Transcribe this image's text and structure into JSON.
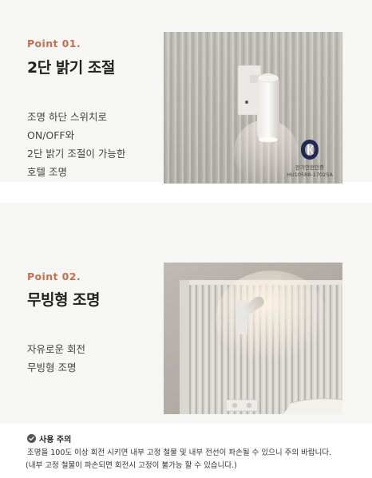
{
  "colors": {
    "accent": "#c8704a",
    "panel_bg": "#f6f6f5",
    "text_dark": "#222222",
    "text_body": "#444444"
  },
  "point1": {
    "label": "Point 01.",
    "title": "2단 밝기 조절",
    "desc": [
      "조명 하단 스위치로",
      "ON/OFF와",
      "2단 밝기 조절이 가능한",
      "호텔 조명"
    ],
    "photo_icon": "wall-lamp-photo",
    "kc": {
      "mark": "KC",
      "line1": "전기안전인증",
      "line2": "HU10588-17025A"
    }
  },
  "point2": {
    "label": "Point 02.",
    "title": "무빙형 조명",
    "desc": [
      "자유로운 회전",
      "무빙형 조명"
    ],
    "photo_icon": "bedroom-lamp-photo"
  },
  "caution": {
    "icon": "check-circle-icon",
    "title": "사용 주의",
    "lines": [
      "조명을 100도 이상 회전 시키면 내부 고정 철물 및 내부 전선이 파손될 수 있으니 주의 바랍니다.",
      "(내부 고정 철물이 파손되면 회전시 고정이 불가능 할 수 있습니다.)"
    ]
  }
}
